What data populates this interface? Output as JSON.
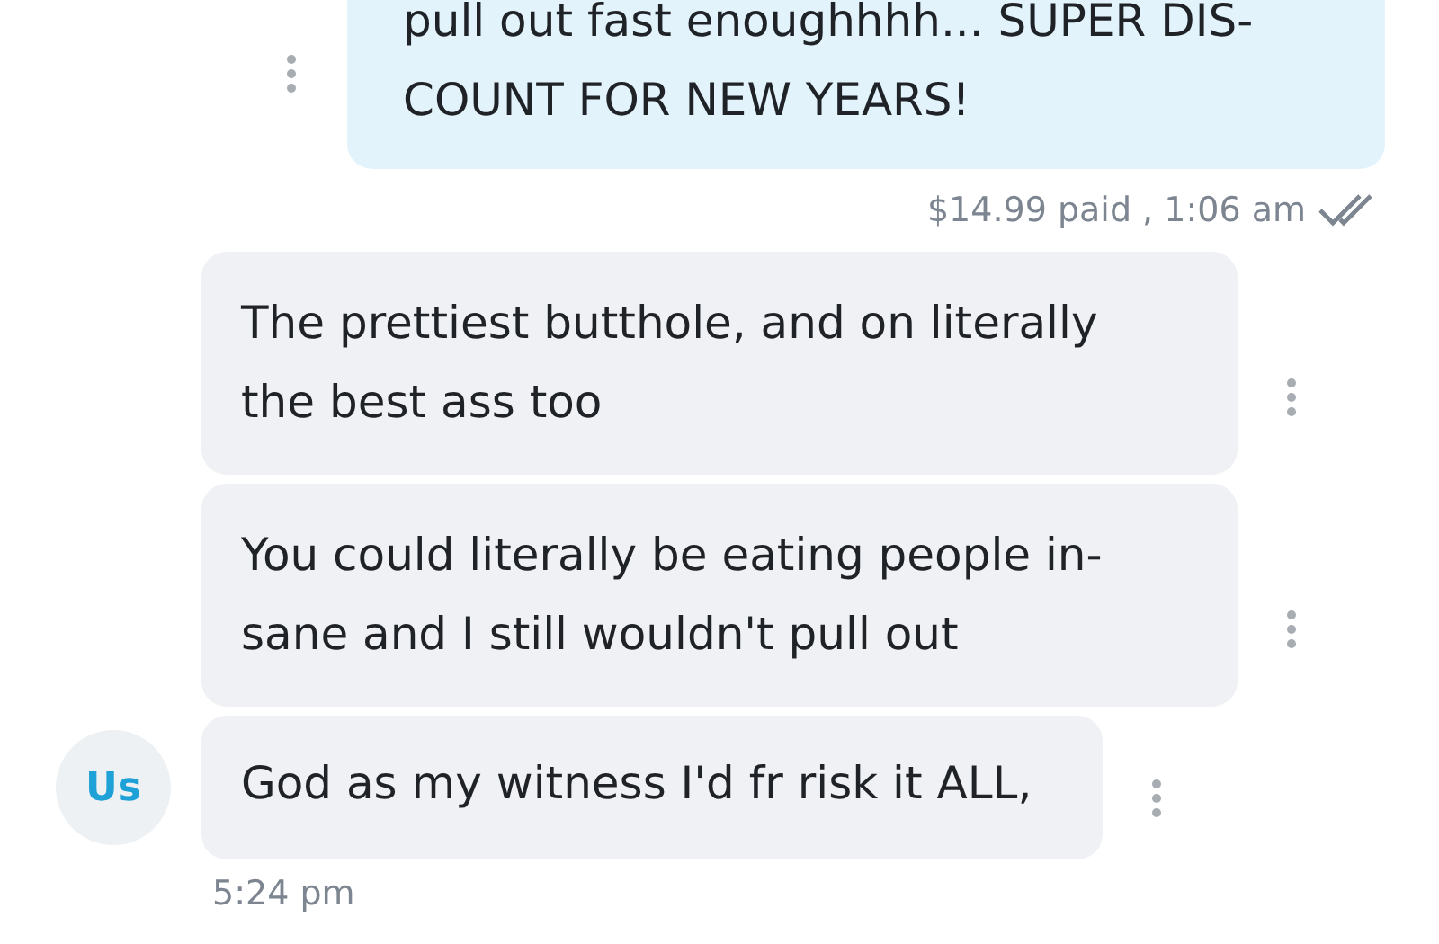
{
  "messages": [
    {
      "kind": "outgoing",
      "lines": [
        "pull out fast enoughhhh... SUPER DIS-",
        "COUNT FOR NEW YEARS!"
      ]
    },
    {
      "kind": "incoming",
      "lines": [
        "The prettiest butthole, and on literally",
        "the best ass too"
      ]
    },
    {
      "kind": "incoming",
      "lines": [
        "You could literally be eating people in-",
        "sane and I still wouldn't pull out"
      ]
    },
    {
      "kind": "incoming",
      "lines": [
        "God as my witness I'd fr risk it ALL,"
      ],
      "avatar": "Us"
    }
  ],
  "outgoing_meta": {
    "text": "$14.99 paid , 1:06 am",
    "read": true
  },
  "last_time": "5:24 pm"
}
